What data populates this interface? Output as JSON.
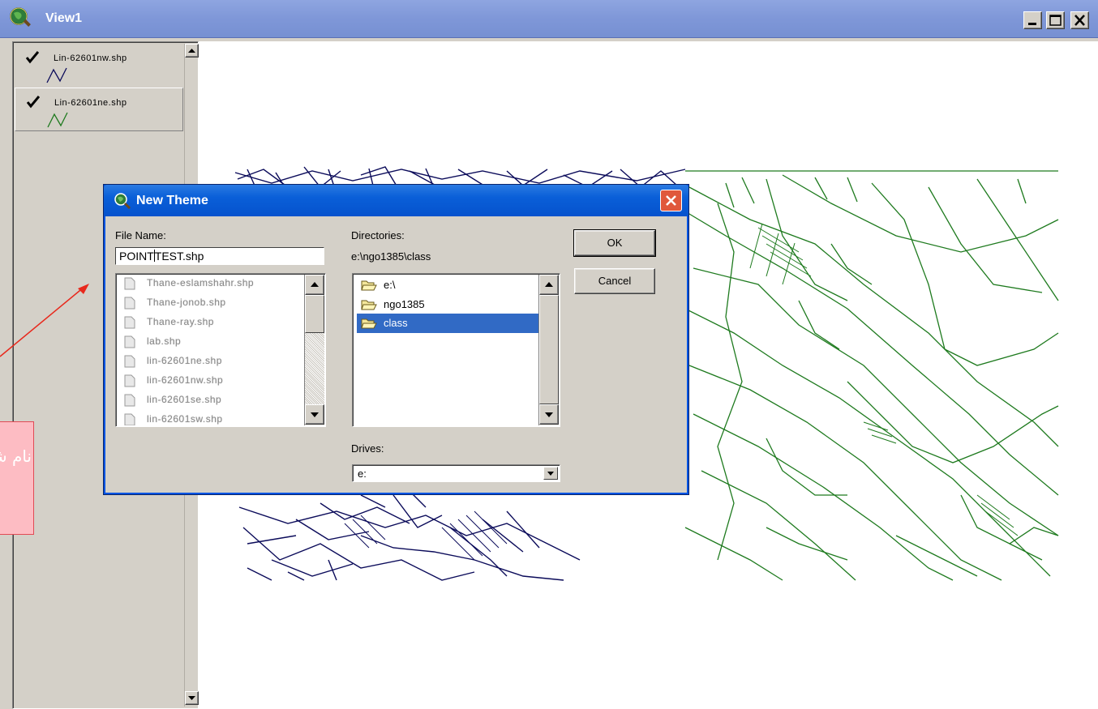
{
  "window": {
    "title": "View1",
    "minimize_icon": "minimize-icon",
    "maximize_icon": "maximize-icon",
    "close_icon": "close-icon"
  },
  "toc": {
    "layers": [
      {
        "name": "Lin-62601nw.shp",
        "checked": true,
        "color": "#0b0b5a"
      },
      {
        "name": "Lin-62601ne.shp",
        "checked": true,
        "color": "#1e7a1e"
      }
    ]
  },
  "map": {
    "colors": {
      "nw_lines": "#0b0b5a",
      "ne_lines": "#1e7a1e"
    }
  },
  "dialog": {
    "title": "New Theme",
    "file_name_label": "File Name:",
    "file_name_prefix": "POINT",
    "file_name_suffix": "TEST.shp",
    "directories_label": "Directories:",
    "current_path": "e:\\ngo1385\\class",
    "files": [
      "Thane-eslamshahr.shp",
      "Thane-jonob.shp",
      "Thane-ray.shp",
      "lab.shp",
      "lin-62601ne.shp",
      "lin-62601nw.shp",
      "lin-62601se.shp",
      "lin-62601sw.shp"
    ],
    "directories": [
      {
        "name": "e:\\",
        "selected": false
      },
      {
        "name": "ngo1385",
        "selected": false
      },
      {
        "name": "class",
        "selected": true
      }
    ],
    "drives_label": "Drives:",
    "drive_value": "e:",
    "ok_label": "OK",
    "cancel_label": "Cancel"
  },
  "annotation": {
    "text": "نام شد",
    "color": "#fdbcc3",
    "arrow_color": "#e8281c"
  }
}
